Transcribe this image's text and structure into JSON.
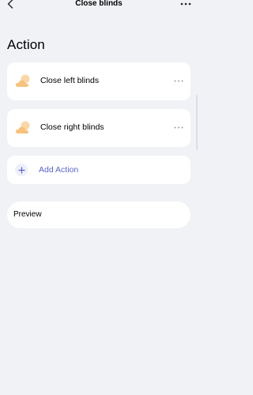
{
  "header": {
    "title": "Close blinds",
    "back_icon": "chevron-left-icon",
    "more_icon": "ellipsis-icon"
  },
  "section": {
    "heading": "Action"
  },
  "actions": [
    {
      "label": "Close left blinds",
      "icon": "cloud-sun-icon"
    },
    {
      "label": "Close right blinds",
      "icon": "cloud-sun-icon"
    }
  ],
  "add_action": {
    "label": "Add Action",
    "icon": "plus-icon"
  },
  "preview": {
    "label": "Preview"
  },
  "colors": {
    "background": "#f1f2f6",
    "card": "#ffffff",
    "accent": "#5965c7",
    "cloud": "#f6c27e",
    "icon_gray": "#9a9ca3"
  }
}
